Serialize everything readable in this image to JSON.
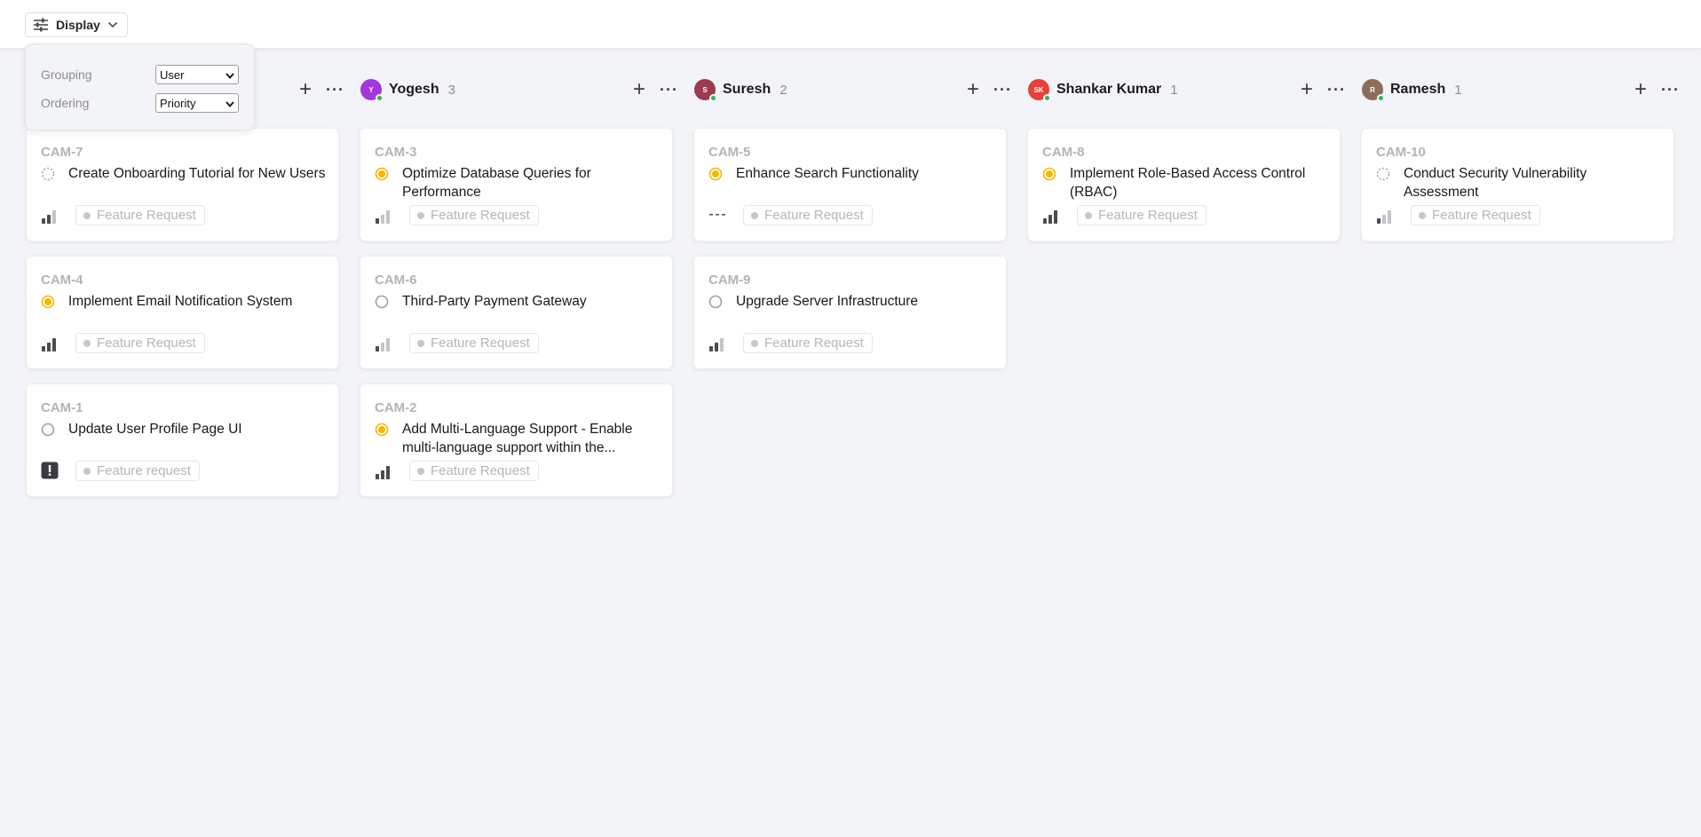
{
  "toolbar": {
    "display_label": "Display",
    "display_icon": "sliders-icon",
    "chevron_icon": "chevron-down-icon"
  },
  "display_popover": {
    "grouping_label": "Grouping",
    "grouping_value": "User",
    "ordering_label": "Ordering",
    "ordering_value": "Priority"
  },
  "colors": {
    "accent_yellow": "#f5b800",
    "online_green": "#2fb552",
    "background": "#f3f4f8"
  },
  "columns": [
    {
      "name": "",
      "count": "",
      "avatar_initials": "",
      "avatar_color": "",
      "cards": [
        {
          "id": "CAM-7",
          "title": "Create Onboarding Tutorial for New Users",
          "status": "backlog",
          "priority": "medium",
          "label": "Feature Request"
        },
        {
          "id": "CAM-4",
          "title": "Implement Email Notification System",
          "status": "in-progress",
          "priority": "high",
          "label": "Feature Request"
        },
        {
          "id": "CAM-1",
          "title": "Update User Profile Page UI",
          "status": "todo",
          "priority": "urgent",
          "label": "Feature request"
        }
      ]
    },
    {
      "name": "Yogesh",
      "count": "3",
      "avatar_initials": "Y",
      "avatar_color": "#a436e0",
      "cards": [
        {
          "id": "CAM-3",
          "title": "Optimize Database Queries for Performance",
          "status": "in-progress",
          "priority": "low",
          "label": "Feature Request"
        },
        {
          "id": "CAM-6",
          "title": "Third-Party Payment Gateway",
          "status": "todo",
          "priority": "low",
          "label": "Feature Request"
        },
        {
          "id": "CAM-2",
          "title": "Add Multi-Language Support - Enable multi-language support within the...",
          "status": "in-progress",
          "priority": "high",
          "label": "Feature Request"
        }
      ]
    },
    {
      "name": "Suresh",
      "count": "2",
      "avatar_initials": "S",
      "avatar_color": "#9c3b4e",
      "cards": [
        {
          "id": "CAM-5",
          "title": "Enhance Search Functionality",
          "status": "in-progress",
          "priority": "none",
          "label": "Feature Request"
        },
        {
          "id": "CAM-9",
          "title": "Upgrade Server Infrastructure",
          "status": "todo",
          "priority": "medium",
          "label": "Feature Request"
        }
      ]
    },
    {
      "name": "Shankar Kumar",
      "count": "1",
      "avatar_initials": "SK",
      "avatar_color": "#e8413a",
      "cards": [
        {
          "id": "CAM-8",
          "title": "Implement Role-Based Access Control (RBAC)",
          "status": "in-progress",
          "priority": "high",
          "label": "Feature Request"
        }
      ]
    },
    {
      "name": "Ramesh",
      "count": "1",
      "avatar_initials": "R",
      "avatar_color": "#8b6d5c",
      "cards": [
        {
          "id": "CAM-10",
          "title": "Conduct Security Vulnerability Assessment",
          "status": "backlog",
          "priority": "low",
          "label": "Feature Request"
        }
      ]
    }
  ]
}
